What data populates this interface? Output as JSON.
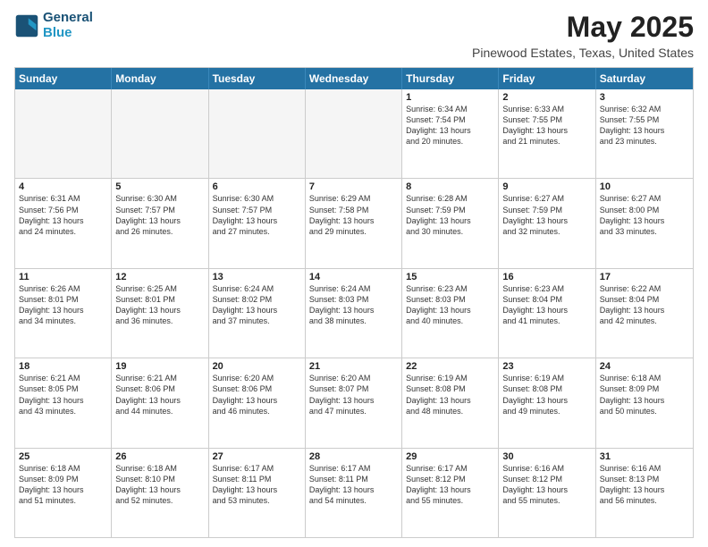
{
  "logo": {
    "line1": "General",
    "line2": "Blue"
  },
  "title": "May 2025",
  "subtitle": "Pinewood Estates, Texas, United States",
  "header_days": [
    "Sunday",
    "Monday",
    "Tuesday",
    "Wednesday",
    "Thursday",
    "Friday",
    "Saturday"
  ],
  "rows": [
    [
      {
        "day": "",
        "text": "",
        "empty": true
      },
      {
        "day": "",
        "text": "",
        "empty": true
      },
      {
        "day": "",
        "text": "",
        "empty": true
      },
      {
        "day": "",
        "text": "",
        "empty": true
      },
      {
        "day": "1",
        "text": "Sunrise: 6:34 AM\nSunset: 7:54 PM\nDaylight: 13 hours\nand 20 minutes."
      },
      {
        "day": "2",
        "text": "Sunrise: 6:33 AM\nSunset: 7:55 PM\nDaylight: 13 hours\nand 21 minutes."
      },
      {
        "day": "3",
        "text": "Sunrise: 6:32 AM\nSunset: 7:55 PM\nDaylight: 13 hours\nand 23 minutes."
      }
    ],
    [
      {
        "day": "4",
        "text": "Sunrise: 6:31 AM\nSunset: 7:56 PM\nDaylight: 13 hours\nand 24 minutes."
      },
      {
        "day": "5",
        "text": "Sunrise: 6:30 AM\nSunset: 7:57 PM\nDaylight: 13 hours\nand 26 minutes."
      },
      {
        "day": "6",
        "text": "Sunrise: 6:30 AM\nSunset: 7:57 PM\nDaylight: 13 hours\nand 27 minutes."
      },
      {
        "day": "7",
        "text": "Sunrise: 6:29 AM\nSunset: 7:58 PM\nDaylight: 13 hours\nand 29 minutes."
      },
      {
        "day": "8",
        "text": "Sunrise: 6:28 AM\nSunset: 7:59 PM\nDaylight: 13 hours\nand 30 minutes."
      },
      {
        "day": "9",
        "text": "Sunrise: 6:27 AM\nSunset: 7:59 PM\nDaylight: 13 hours\nand 32 minutes."
      },
      {
        "day": "10",
        "text": "Sunrise: 6:27 AM\nSunset: 8:00 PM\nDaylight: 13 hours\nand 33 minutes."
      }
    ],
    [
      {
        "day": "11",
        "text": "Sunrise: 6:26 AM\nSunset: 8:01 PM\nDaylight: 13 hours\nand 34 minutes."
      },
      {
        "day": "12",
        "text": "Sunrise: 6:25 AM\nSunset: 8:01 PM\nDaylight: 13 hours\nand 36 minutes."
      },
      {
        "day": "13",
        "text": "Sunrise: 6:24 AM\nSunset: 8:02 PM\nDaylight: 13 hours\nand 37 minutes."
      },
      {
        "day": "14",
        "text": "Sunrise: 6:24 AM\nSunset: 8:03 PM\nDaylight: 13 hours\nand 38 minutes."
      },
      {
        "day": "15",
        "text": "Sunrise: 6:23 AM\nSunset: 8:03 PM\nDaylight: 13 hours\nand 40 minutes."
      },
      {
        "day": "16",
        "text": "Sunrise: 6:23 AM\nSunset: 8:04 PM\nDaylight: 13 hours\nand 41 minutes."
      },
      {
        "day": "17",
        "text": "Sunrise: 6:22 AM\nSunset: 8:04 PM\nDaylight: 13 hours\nand 42 minutes."
      }
    ],
    [
      {
        "day": "18",
        "text": "Sunrise: 6:21 AM\nSunset: 8:05 PM\nDaylight: 13 hours\nand 43 minutes."
      },
      {
        "day": "19",
        "text": "Sunrise: 6:21 AM\nSunset: 8:06 PM\nDaylight: 13 hours\nand 44 minutes."
      },
      {
        "day": "20",
        "text": "Sunrise: 6:20 AM\nSunset: 8:06 PM\nDaylight: 13 hours\nand 46 minutes."
      },
      {
        "day": "21",
        "text": "Sunrise: 6:20 AM\nSunset: 8:07 PM\nDaylight: 13 hours\nand 47 minutes."
      },
      {
        "day": "22",
        "text": "Sunrise: 6:19 AM\nSunset: 8:08 PM\nDaylight: 13 hours\nand 48 minutes."
      },
      {
        "day": "23",
        "text": "Sunrise: 6:19 AM\nSunset: 8:08 PM\nDaylight: 13 hours\nand 49 minutes."
      },
      {
        "day": "24",
        "text": "Sunrise: 6:18 AM\nSunset: 8:09 PM\nDaylight: 13 hours\nand 50 minutes."
      }
    ],
    [
      {
        "day": "25",
        "text": "Sunrise: 6:18 AM\nSunset: 8:09 PM\nDaylight: 13 hours\nand 51 minutes."
      },
      {
        "day": "26",
        "text": "Sunrise: 6:18 AM\nSunset: 8:10 PM\nDaylight: 13 hours\nand 52 minutes."
      },
      {
        "day": "27",
        "text": "Sunrise: 6:17 AM\nSunset: 8:11 PM\nDaylight: 13 hours\nand 53 minutes."
      },
      {
        "day": "28",
        "text": "Sunrise: 6:17 AM\nSunset: 8:11 PM\nDaylight: 13 hours\nand 54 minutes."
      },
      {
        "day": "29",
        "text": "Sunrise: 6:17 AM\nSunset: 8:12 PM\nDaylight: 13 hours\nand 55 minutes."
      },
      {
        "day": "30",
        "text": "Sunrise: 6:16 AM\nSunset: 8:12 PM\nDaylight: 13 hours\nand 55 minutes."
      },
      {
        "day": "31",
        "text": "Sunrise: 6:16 AM\nSunset: 8:13 PM\nDaylight: 13 hours\nand 56 minutes."
      }
    ]
  ]
}
